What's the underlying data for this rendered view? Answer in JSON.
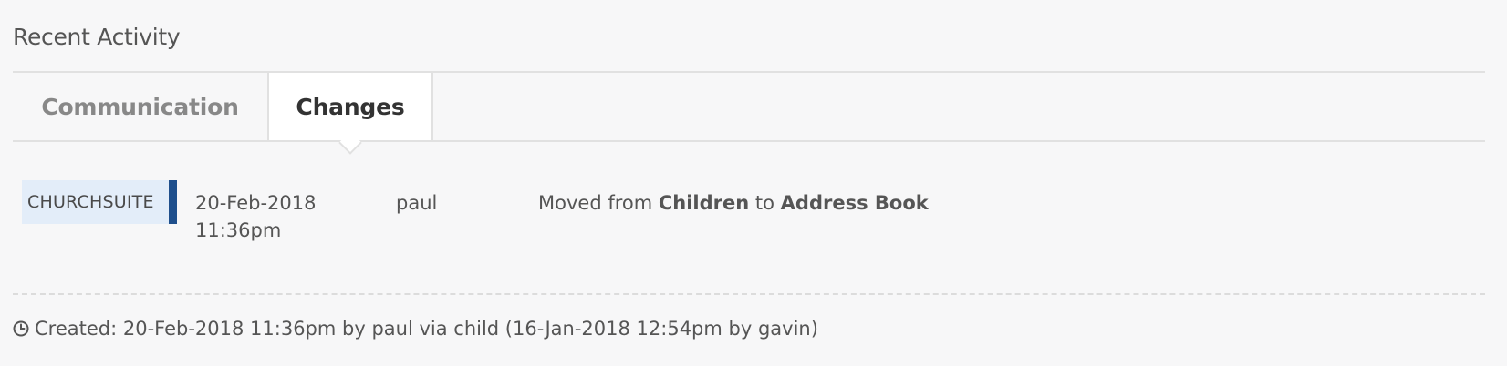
{
  "section": {
    "title": "Recent Activity"
  },
  "tabs": [
    {
      "label": "Communication",
      "active": false
    },
    {
      "label": "Changes",
      "active": true
    }
  ],
  "activity": [
    {
      "source": "CHURCHSUITE",
      "date": "20-Feb-2018",
      "time": "11:36pm",
      "user": "paul",
      "description": {
        "prefix": "Moved from ",
        "from": "Children",
        "middle": " to ",
        "to": "Address Book"
      }
    }
  ],
  "colors": {
    "source_badge_bg": "#e3edf9",
    "source_badge_accent": "#1f4f8c"
  },
  "footer": {
    "icon": "clock-icon",
    "text": "Created: 20-Feb-2018 11:36pm by paul via child (16-Jan-2018 12:54pm by gavin)"
  }
}
